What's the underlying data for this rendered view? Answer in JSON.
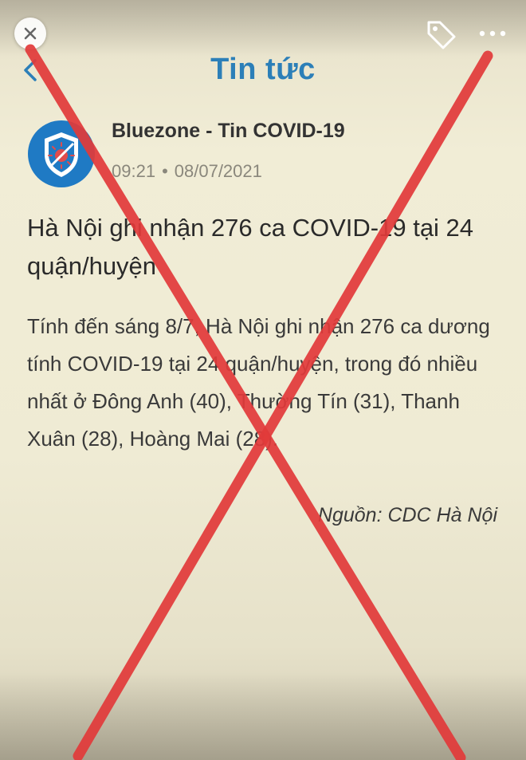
{
  "header": {
    "title": "Tin tức",
    "back_icon": "chevron-left-icon",
    "close_icon": "close-icon",
    "tag_icon": "tag-icon",
    "more_icon": "more-horizontal-icon"
  },
  "post": {
    "source_name": "Bluezone - Tin COVID-19",
    "time": "09:21",
    "date": "08/07/2021",
    "headline": "Hà Nội ghi nhận 276 ca COVID-19 tại 24 quận/huyện",
    "body": "Tính đến sáng 8/7, Hà Nội ghi nhận 276 ca dương tính COVID-19 tại 24 quận/huyện, trong đó nhiều nhất ở Đông Anh (40), Thường Tín (31), Thanh Xuân (28), Hoàng Mai (28).",
    "credit": "Nguồn: CDC Hà Nội"
  },
  "colors": {
    "title_blue": "#2c7fb8",
    "logo_blue": "#1f7ac4",
    "cross_red": "#e23a3a",
    "paper": "#efebd4"
  }
}
